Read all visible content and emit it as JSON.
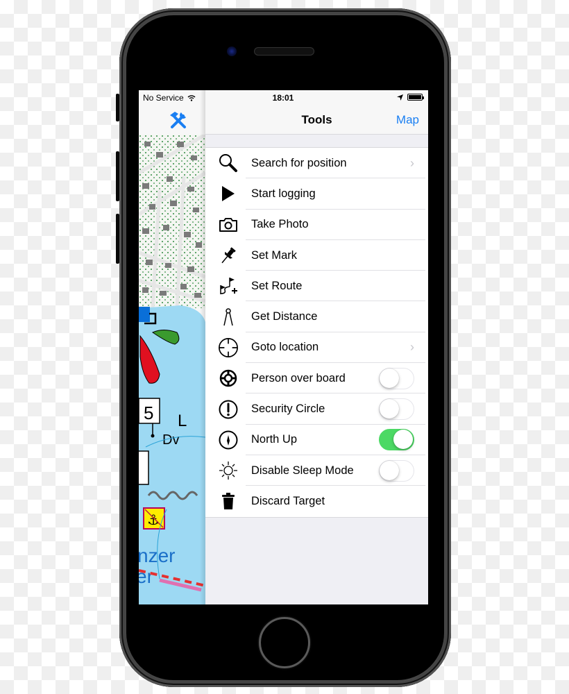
{
  "status_bar": {
    "carrier": "No Service",
    "time": "18:01",
    "icons": [
      "wifi-icon",
      "location-arrow-icon",
      "battery-icon"
    ]
  },
  "map_panel": {
    "tools_icon": "hammer-wrench-icon",
    "map_labels": {
      "depth_number": "5",
      "light_char": "L",
      "seabed": "Dv",
      "place_name_line1": "nzer",
      "place_name_line2": "er"
    }
  },
  "nav": {
    "title": "Tools",
    "right_button": "Map"
  },
  "colors": {
    "accent": "#1a7ff2",
    "toggle_on": "#4cd964",
    "sea": "#9dd9f3",
    "green_light": "#3a9a2e",
    "red_light": "#e01020"
  },
  "tools": [
    {
      "label": "Search for position",
      "icon": "search-icon",
      "accessory": "chevron"
    },
    {
      "label": "Start logging",
      "icon": "play-icon",
      "accessory": "none"
    },
    {
      "label": "Take Photo",
      "icon": "camera-icon",
      "accessory": "none"
    },
    {
      "label": "Set Mark",
      "icon": "pushpin-icon",
      "accessory": "none"
    },
    {
      "label": "Set Route",
      "icon": "route-flags-icon",
      "accessory": "none"
    },
    {
      "label": "Get Distance",
      "icon": "divider-compass-icon",
      "accessory": "none"
    },
    {
      "label": "Goto location",
      "icon": "crosshair-icon",
      "accessory": "chevron"
    },
    {
      "label": "Person over board",
      "icon": "lifebuoy-icon",
      "accessory": "toggle",
      "on": false
    },
    {
      "label": "Security Circle",
      "icon": "exclamation-circle-icon",
      "accessory": "toggle",
      "on": false
    },
    {
      "label": "North Up",
      "icon": "compass-icon",
      "accessory": "toggle",
      "on": true
    },
    {
      "label": "Disable Sleep Mode",
      "icon": "sun-icon",
      "accessory": "toggle",
      "on": false
    },
    {
      "label": "Discard Target",
      "icon": "trash-icon",
      "accessory": "none"
    }
  ]
}
